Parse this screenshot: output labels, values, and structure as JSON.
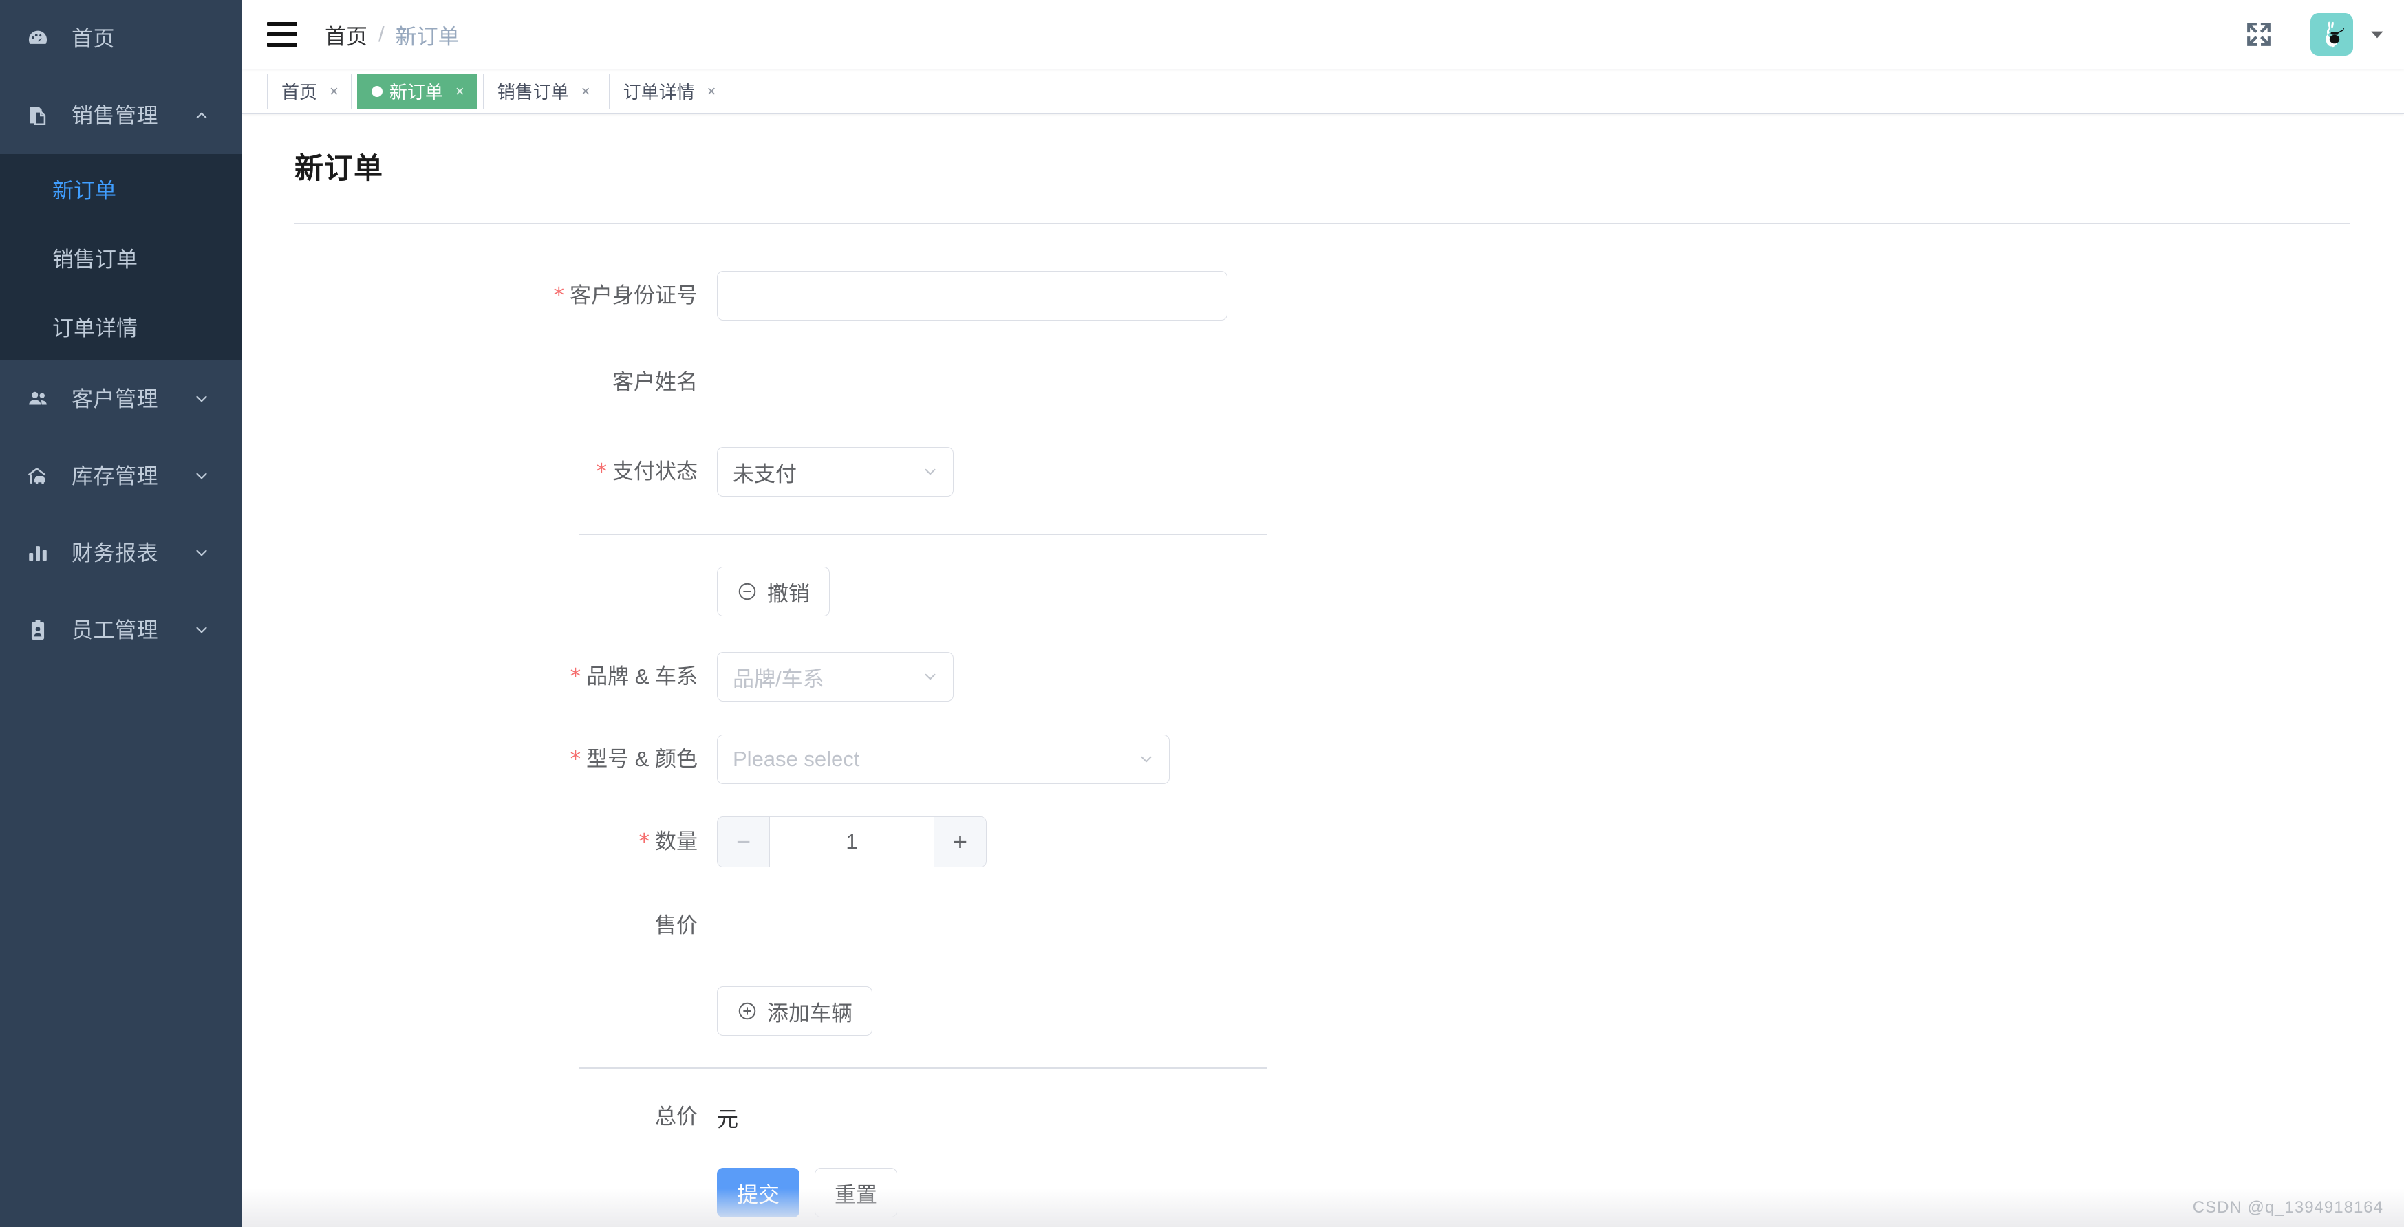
{
  "sidebar": {
    "items": [
      {
        "label": "首页",
        "icon": "dashboard-icon",
        "has_children": false,
        "expanded": false
      },
      {
        "label": "销售管理",
        "icon": "document-copy-icon",
        "has_children": true,
        "expanded": true,
        "children": [
          {
            "label": "新订单",
            "active": true
          },
          {
            "label": "销售订单",
            "active": false
          },
          {
            "label": "订单详情",
            "active": false
          }
        ]
      },
      {
        "label": "客户管理",
        "icon": "users-icon",
        "has_children": true,
        "expanded": false
      },
      {
        "label": "库存管理",
        "icon": "garage-car-icon",
        "has_children": true,
        "expanded": false
      },
      {
        "label": "财务报表",
        "icon": "bar-chart-icon",
        "has_children": true,
        "expanded": false
      },
      {
        "label": "员工管理",
        "icon": "id-badge-icon",
        "has_children": true,
        "expanded": false
      }
    ]
  },
  "navbar": {
    "hamburger_icon": "hamburger-icon",
    "breadcrumb": [
      "首页",
      "新订单"
    ],
    "breadcrumb_separator": "/",
    "fullscreen_icon": "fullscreen-icon",
    "avatar_icon": "rabbit-avatar-icon",
    "avatar_bg": "#79d4cf",
    "caret_icon": "chevron-down-icon"
  },
  "tabs": [
    {
      "label": "首页",
      "active": false,
      "close": "×"
    },
    {
      "label": "新订单",
      "active": true,
      "close": "×"
    },
    {
      "label": "销售订单",
      "active": false,
      "close": "×"
    },
    {
      "label": "订单详情",
      "active": false,
      "close": "×"
    }
  ],
  "page": {
    "title": "新订单"
  },
  "form": {
    "id_number": {
      "label": "客户身份证号",
      "required": true,
      "value": "",
      "placeholder": ""
    },
    "customer_name": {
      "label": "客户姓名",
      "required": false,
      "value": ""
    },
    "pay_status": {
      "label": "支付状态",
      "required": true,
      "value": "未支付"
    },
    "revoke_button": {
      "label": "撤销",
      "icon": "minus-circle-icon"
    },
    "brand_series": {
      "label": "品牌 & 车系",
      "required": true,
      "value": "",
      "placeholder": "品牌/车系"
    },
    "model_color": {
      "label": "型号 & 颜色",
      "required": true,
      "value": "",
      "placeholder": "Please select"
    },
    "quantity": {
      "label": "数量",
      "required": true,
      "value": "1",
      "minus": "−",
      "plus": "+"
    },
    "price": {
      "label": "售价",
      "required": false,
      "value": ""
    },
    "add_vehicle_button": {
      "label": "添加车辆",
      "icon": "plus-circle-icon"
    },
    "total": {
      "label": "总价",
      "value": "",
      "unit": "元"
    },
    "submit_button": {
      "label": "提交"
    },
    "reset_button": {
      "label": "重置"
    }
  },
  "colors": {
    "sidebar_bg": "#304156",
    "submenu_bg": "#1f2d3d",
    "active_link": "#409eff",
    "tab_active_bg": "#5cb484",
    "primary_button": "#5a9cf8",
    "required_star": "#f56c6c"
  },
  "watermark": {
    "text": "CSDN @q_1394918164"
  }
}
